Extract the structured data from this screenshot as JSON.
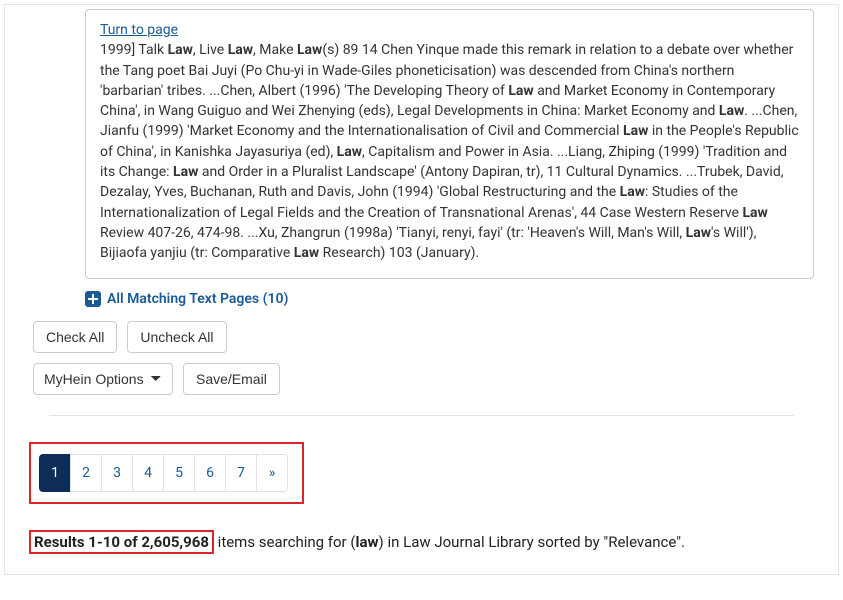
{
  "snippet": {
    "turn_label": "Turn to page",
    "parts": [
      {
        "t": "1999] Talk "
      },
      {
        "t": "Law",
        "b": true
      },
      {
        "t": ", Live "
      },
      {
        "t": "Law",
        "b": true
      },
      {
        "t": ", Make "
      },
      {
        "t": "Law",
        "b": true
      },
      {
        "t": "(s) 89 14 Chen Yinque made this remark in relation to a debate over whether the Tang poet Bai Juyi (Po Chu-yi in Wade-Giles phoneticisation) was descended from China's northern 'barbarian' tribes. ...Chen, Albert (1996) 'The Developing Theory of "
      },
      {
        "t": "Law",
        "b": true
      },
      {
        "t": " and Market Economy in Contemporary China', in Wang Guiguo and Wei Zhenying (eds), Legal Developments in China: Market Economy and "
      },
      {
        "t": "Law",
        "b": true
      },
      {
        "t": ". ...Chen, Jianfu (1999) 'Market Economy and the Internationalisation of Civil and Commercial "
      },
      {
        "t": "Law",
        "b": true
      },
      {
        "t": " in the People's Republic of China', in Kanishka Jayasuriya (ed), "
      },
      {
        "t": "Law",
        "b": true
      },
      {
        "t": ", Capitalism and Power in Asia. ...Liang, Zhiping (1999) 'Tradition and its Change: "
      },
      {
        "t": "Law",
        "b": true
      },
      {
        "t": " and Order in a Pluralist Landscape' (Antony Dapiran, tr), 11 Cultural Dynamics. ...Trubek, David, Dezalay, Yves, Buchanan, Ruth and Davis, John (1994) 'Global Restructuring and the "
      },
      {
        "t": "Law",
        "b": true
      },
      {
        "t": ": Studies of the Internationalization of Legal Fields and the Creation of Transnational Arenas', 44 Case Western Reserve "
      },
      {
        "t": "Law",
        "b": true
      },
      {
        "t": " Review 407-26, 474-98. ...Xu, Zhangrun (1998a) 'Tianyi, renyi, fayi' (tr: 'Heaven's Will, Man's Will, "
      },
      {
        "t": "Law",
        "b": true
      },
      {
        "t": "'s Will'), Bijiaofa yanjiu (tr: Comparative "
      },
      {
        "t": "Law",
        "b": true
      },
      {
        "t": " Research) 103 (January)."
      }
    ]
  },
  "matching_text": "All Matching Text Pages (10)",
  "buttons": {
    "check_all": "Check All",
    "uncheck_all": "Uncheck All",
    "save_email": "Save/Email"
  },
  "select": {
    "label": "MyHein Options"
  },
  "pagination": {
    "pages": [
      "1",
      "2",
      "3",
      "4",
      "5",
      "6",
      "7"
    ],
    "next": "»",
    "active": 0
  },
  "results": {
    "count_text": "Results 1-10 of 2,605,968",
    "suffix_prefix": " items searching for (",
    "query": "law",
    "suffix_rest": ") in Law Journal Library sorted by \"Relevance\"."
  }
}
